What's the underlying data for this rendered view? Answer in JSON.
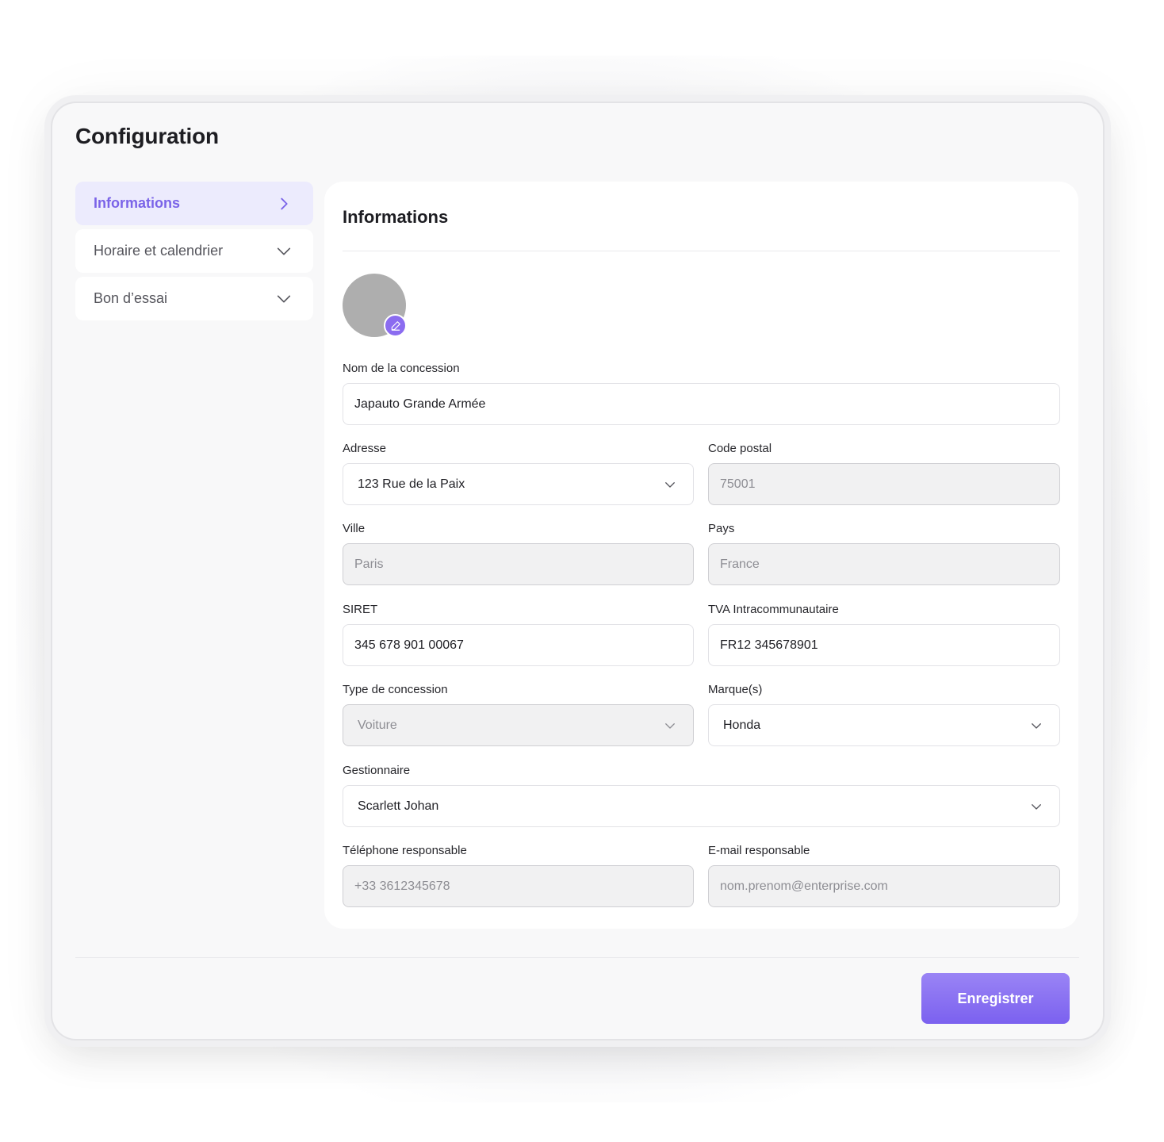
{
  "page": {
    "title": "Configuration"
  },
  "sidebar": {
    "items": [
      {
        "label": "Informations",
        "icon": "chevron-right-icon",
        "active": true
      },
      {
        "label": "Horaire et calendrier",
        "icon": "chevron-down-icon",
        "active": false
      },
      {
        "label": "Bon d’essai",
        "icon": "chevron-down-icon",
        "active": false
      }
    ]
  },
  "form": {
    "title": "Informations",
    "avatar": {
      "edit_icon": "pencil-icon"
    },
    "fields": {
      "nom": {
        "label": "Nom de la concession",
        "value": "Japauto Grande Armée"
      },
      "adresse": {
        "label": "Adresse",
        "value": "123 Rue de la Paix"
      },
      "code_postal": {
        "label": "Code postal",
        "value": "75001"
      },
      "ville": {
        "label": "Ville",
        "value": "Paris"
      },
      "pays": {
        "label": "Pays",
        "value": "France"
      },
      "siret": {
        "label": "SIRET",
        "value": "345 678 901 00067"
      },
      "tva": {
        "label": "TVA Intracommunautaire",
        "value": "FR12 345678901"
      },
      "type": {
        "label": "Type de concession",
        "value": "Voiture"
      },
      "marques": {
        "label": "Marque(s)",
        "value": "Honda"
      },
      "gestionnaire": {
        "label": "Gestionnaire",
        "value": "Scarlett Johan"
      },
      "telephone": {
        "label": "Téléphone responsable",
        "value": "+33 3612345678"
      },
      "email": {
        "label": "E-mail responsable",
        "value": "nom.prenom@enterprise.com"
      }
    }
  },
  "footer": {
    "save_label": "Enregistrer"
  },
  "colors": {
    "accent": "#7b61ef",
    "accent_light": "#ecebfd",
    "disabled_bg": "#f1f1f2"
  }
}
